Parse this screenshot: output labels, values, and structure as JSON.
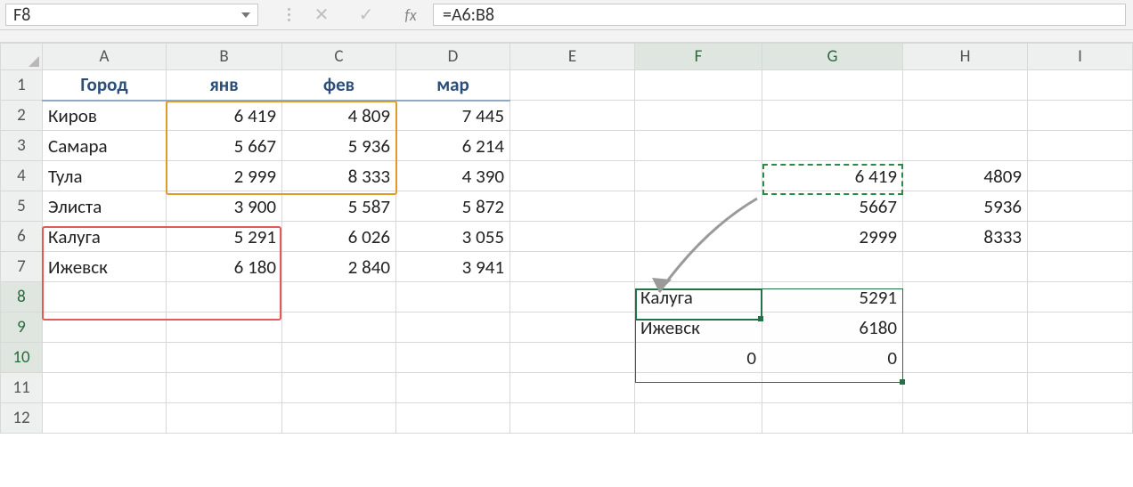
{
  "nameBox": "F8",
  "formula": "=A6:B8",
  "columns": [
    "A",
    "B",
    "C",
    "D",
    "E",
    "F",
    "G",
    "H",
    "I"
  ],
  "rows": [
    "1",
    "2",
    "3",
    "4",
    "5",
    "6",
    "7",
    "8",
    "9",
    "10",
    "11",
    "12"
  ],
  "headerRow": {
    "A": "Город",
    "B": "янв",
    "C": "фев",
    "D": "мар"
  },
  "data": [
    {
      "city": "Киров",
      "jan": "6 419",
      "feb": "4 809",
      "mar": "7 445"
    },
    {
      "city": "Самара",
      "jan": "5 667",
      "feb": "5 936",
      "mar": "6 214"
    },
    {
      "city": "Тула",
      "jan": "2 999",
      "feb": "8 333",
      "mar": "4 390"
    },
    {
      "city": "Элиста",
      "jan": "3 900",
      "feb": "5 587",
      "mar": "5 872"
    },
    {
      "city": "Калуга",
      "jan": "5 291",
      "feb": "6 026",
      "mar": "3 055"
    },
    {
      "city": "Ижевск",
      "jan": "6 180",
      "feb": "2 840",
      "mar": "3 941"
    }
  ],
  "rightBlock1": [
    {
      "g": "6 419",
      "h": "4809"
    },
    {
      "g": "5667",
      "h": "5936"
    },
    {
      "g": "2999",
      "h": "8333"
    }
  ],
  "rightBlock2": [
    {
      "f": "Калуга",
      "g": "5291"
    },
    {
      "f": "Ижевск",
      "g": "6180"
    },
    {
      "f": "0",
      "g": "0"
    }
  ],
  "icons": {
    "cancel": "✕",
    "enter": "✓",
    "fx": "fx"
  }
}
